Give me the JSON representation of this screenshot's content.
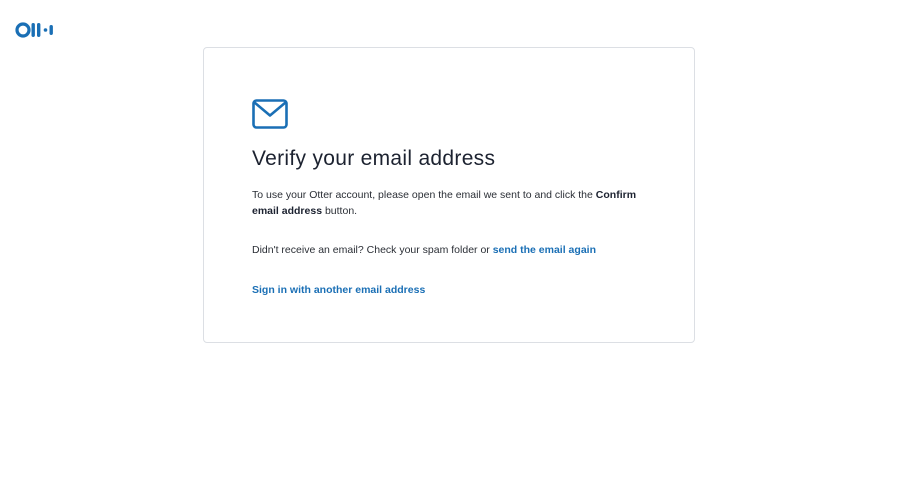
{
  "brand": {
    "logo_icon": "otter-logo-icon",
    "accent_color": "#1a6fb5"
  },
  "card": {
    "icon": "mail-icon",
    "title": "Verify your email address",
    "instructions_prefix": "To use your Otter account, please open the email we sent to and click the ",
    "instructions_bold": "Confirm email address",
    "instructions_suffix": " button.",
    "resend_prefix": "Didn't receive an email? Check your spam folder or ",
    "resend_link": "send the email again",
    "signin_link": "Sign in with another email address"
  }
}
